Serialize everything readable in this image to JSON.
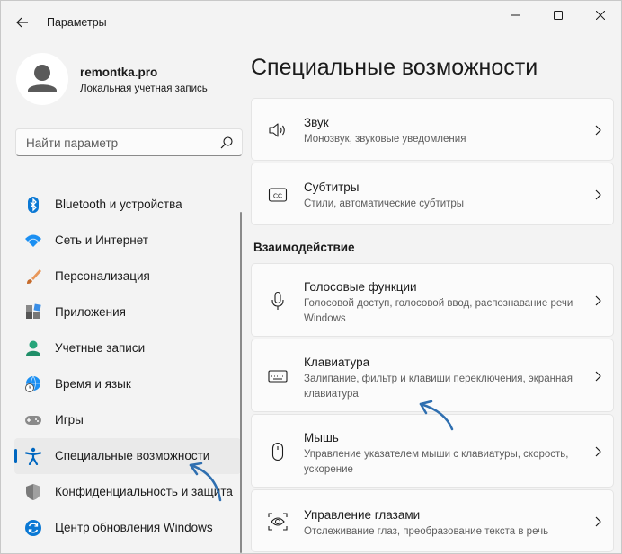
{
  "window": {
    "title": "Параметры"
  },
  "profile": {
    "name": "remontka.pro",
    "account_type": "Локальная учетная запись"
  },
  "search": {
    "placeholder": "Найти параметр"
  },
  "nav": {
    "items": [
      {
        "label": "Bluetooth и устройства",
        "icon": "bluetooth-icon"
      },
      {
        "label": "Сеть и Интернет",
        "icon": "wifi-icon"
      },
      {
        "label": "Персонализация",
        "icon": "brush-icon"
      },
      {
        "label": "Приложения",
        "icon": "apps-icon"
      },
      {
        "label": "Учетные записи",
        "icon": "account-icon"
      },
      {
        "label": "Время и язык",
        "icon": "time-language-icon"
      },
      {
        "label": "Игры",
        "icon": "gamepad-icon"
      },
      {
        "label": "Специальные возможности",
        "icon": "accessibility-icon",
        "active": true
      },
      {
        "label": "Конфиденциальность и защита",
        "icon": "shield-icon"
      },
      {
        "label": "Центр обновления Windows",
        "icon": "update-icon"
      }
    ]
  },
  "main": {
    "title": "Специальные возможности",
    "section_interaction": "Взаимодействие",
    "cards": [
      {
        "title": "Звук",
        "subtitle": "Монозвук, звуковые уведомления",
        "icon": "speaker-icon"
      },
      {
        "title": "Субтитры",
        "subtitle": "Стили, автоматические субтитры",
        "icon": "captions-icon"
      },
      {
        "title": "Голосовые функции",
        "subtitle": "Голосовой доступ, голосовой ввод, распознавание речи Windows",
        "icon": "microphone-icon"
      },
      {
        "title": "Клавиатура",
        "subtitle": "Залипание, фильтр и клавиши переключения, экранная клавиатура",
        "icon": "keyboard-icon"
      },
      {
        "title": "Мышь",
        "subtitle": "Управление указателем мыши с клавиатуры, скорость, ускорение",
        "icon": "mouse-icon"
      },
      {
        "title": "Управление глазами",
        "subtitle": "Отслеживание глаз, преобразование текста в речь",
        "icon": "eye-control-icon"
      }
    ]
  },
  "colors": {
    "accent": "#0067c0",
    "annotation_arrow": "#2f6fb0"
  }
}
